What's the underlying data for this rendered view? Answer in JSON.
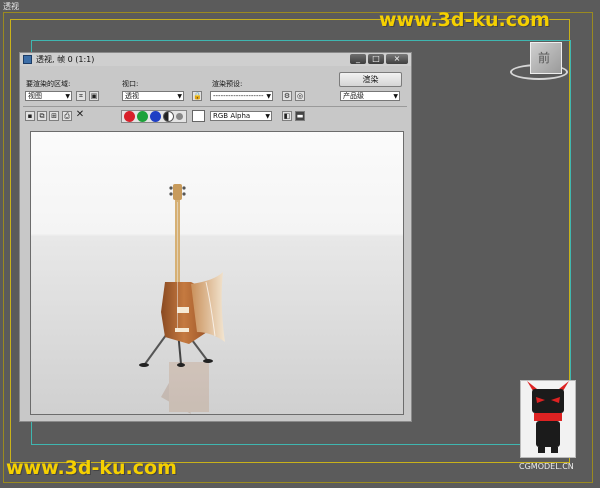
{
  "viewport": {
    "label": "透视"
  },
  "watermark": {
    "top": "www.3d-ku.com",
    "bottom": "www.3d-ku.com"
  },
  "viewcube": {
    "face_label": "前"
  },
  "render_window": {
    "title": "透视, 帧 0 (1:1)",
    "window_buttons": [
      "_",
      "□",
      "×"
    ],
    "area_to_render": {
      "label": "要渲染的区域:",
      "value": "视图"
    },
    "viewport_select": {
      "label": "视口:",
      "value": "透视"
    },
    "render_preset": {
      "label": "渲染预设:",
      "value": "--------------------"
    },
    "render_button": "渲染",
    "production_level": "产品级",
    "channel_select": "RGB Alpha",
    "channel_colors": [
      "#d8202a",
      "#1ea23b",
      "#1f3fc4"
    ]
  },
  "mascot": {
    "label": "CGMODEL.CN"
  },
  "colors": {
    "viewport_bg": "#5b5b5b",
    "safe_frame": "#c9b21a",
    "cyan_frame": "#3fb6b0",
    "watermark": "#f5d000"
  }
}
